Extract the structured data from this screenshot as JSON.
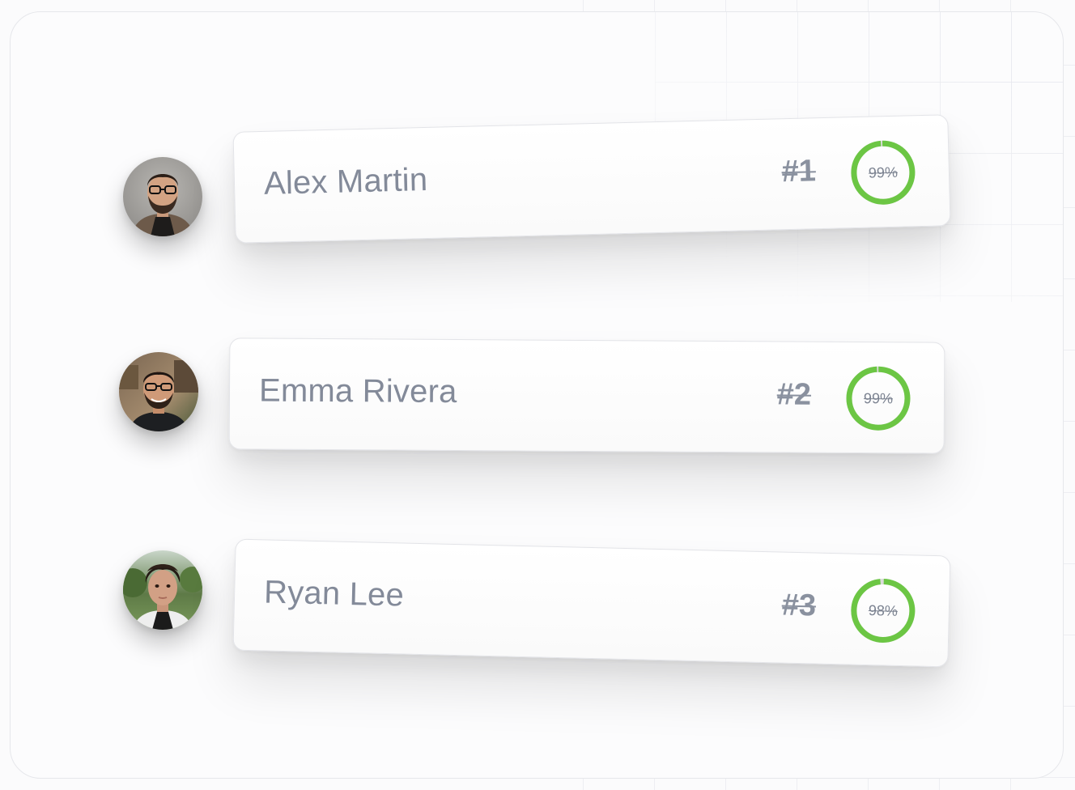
{
  "colors": {
    "progress": "#6cc644",
    "track": "#dcdcdc",
    "text": "#838a99"
  },
  "leaderboard": [
    {
      "name": "Alex Martin",
      "rank": "#1",
      "score_label": "99%",
      "score": 0.99
    },
    {
      "name": "Emma Rivera",
      "rank": "#2",
      "score_label": "99%",
      "score": 0.99
    },
    {
      "name": "Ryan Lee",
      "rank": "#3",
      "score_label": "98%",
      "score": 0.98
    }
  ]
}
